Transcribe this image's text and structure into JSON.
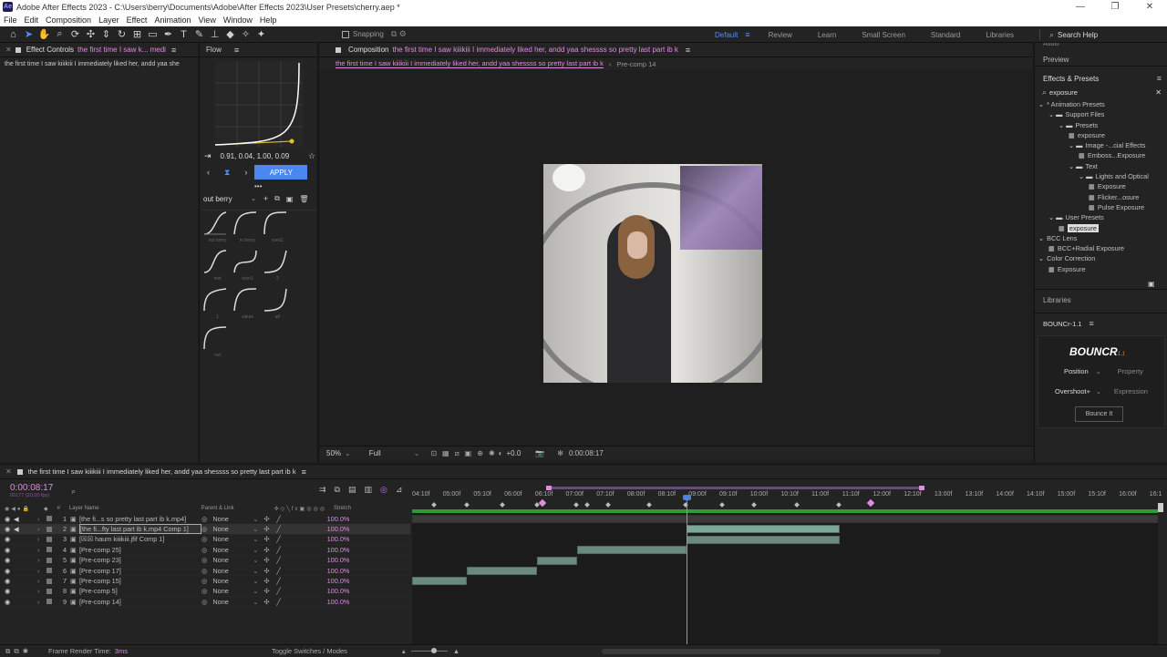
{
  "window": {
    "title": "Adobe After Effects 2023 - C:\\Users\\berry\\Documents\\Adobe\\After Effects 2023\\User Presets\\cherry.aep *",
    "logo": "Ae",
    "controls": [
      "—",
      "❐",
      "✕"
    ]
  },
  "menu": [
    "File",
    "Edit",
    "Composition",
    "Layer",
    "Effect",
    "Animation",
    "View",
    "Window",
    "Help"
  ],
  "toolbar": {
    "snapping": "Snapping",
    "workspaces": [
      "Default",
      "Review",
      "Learn",
      "Small Screen",
      "Standard",
      "Libraries"
    ],
    "active_workspace": "Default",
    "search_placeholder": "Search Help",
    "search_value": "Search Help"
  },
  "effect_controls": {
    "tab_label": "Effect Controls",
    "tab_layer": "the first time I saw k... medi",
    "subtitle": "the first time I saw kiiikiii I immediately liked her, andd yaa she"
  },
  "flow": {
    "tab_label": "Flow",
    "bezier": "0.91, 0.04, 1.00, 0.09",
    "apply": "APPLY",
    "preset_name": "out berry",
    "presets": [
      "out berry",
      "in berry",
      "yves1",
      "mid",
      "toon1",
      "2",
      "1",
      "sakes",
      "ah",
      "out"
    ]
  },
  "composition": {
    "tab_label": "Composition",
    "tab_name": "the first time I saw kiiikiii I immediately liked her, andd yaa shessss so pretty last part ib k",
    "breadcrumb_active": "the first time I saw kiiikiii I immediately liked her, andd yaa shessss so pretty last part ib k",
    "breadcrumb_other": "Pre-comp 14",
    "zoom": "50%",
    "resolution": "Full",
    "exposure": "+0.0",
    "timecode": "0:00:08:17"
  },
  "right_panel": {
    "audio": "Audio",
    "preview": "Preview",
    "effects_presets": "Effects & Presets",
    "search_value": "exposure",
    "tree": [
      {
        "label": "* Animation Presets",
        "depth": 0,
        "kind": "folder-open"
      },
      {
        "label": "Support Files",
        "depth": 1,
        "kind": "folder"
      },
      {
        "label": "Presets",
        "depth": 2,
        "kind": "folder"
      },
      {
        "label": "exposure",
        "depth": 3,
        "kind": "preset"
      },
      {
        "label": "Image -...cial Effects",
        "depth": 3,
        "kind": "folder"
      },
      {
        "label": "Emboss...Exposure",
        "depth": 4,
        "kind": "preset"
      },
      {
        "label": "Text",
        "depth": 3,
        "kind": "folder"
      },
      {
        "label": "Lights and Optical",
        "depth": 4,
        "kind": "folder"
      },
      {
        "label": "Exposure",
        "depth": 5,
        "kind": "preset"
      },
      {
        "label": "Flicker...osure",
        "depth": 5,
        "kind": "preset"
      },
      {
        "label": "Pulse Exposure",
        "depth": 5,
        "kind": "preset"
      },
      {
        "label": "User Presets",
        "depth": 1,
        "kind": "folder"
      },
      {
        "label": "exposure",
        "depth": 2,
        "kind": "preset-selected"
      },
      {
        "label": "BCC Lens",
        "depth": 0,
        "kind": "folder-open"
      },
      {
        "label": "BCC+Radial Exposure",
        "depth": 1,
        "kind": "preset"
      },
      {
        "label": "Color Correction",
        "depth": 0,
        "kind": "folder-open"
      },
      {
        "label": "Exposure",
        "depth": 1,
        "kind": "preset"
      }
    ],
    "libraries": "Libraries",
    "bounce_tab": "BOUNCr-1.1",
    "bounce_logo": "BOUNCR",
    "bounce_version": "1.1",
    "bounce_property": "Position",
    "bounce_property_label": "Property",
    "bounce_expression": "Overshoot+",
    "bounce_expression_label": "Expression",
    "bounce_button": "Bounce It"
  },
  "timeline": {
    "tab_label": "the first time I saw kiiikiii I immediately liked her, andd yaa shessss so pretty last part ib k",
    "timecode": "0:00:08:17",
    "frames": "00177 (20.00 fps)",
    "columns": {
      "layer_name": "Layer Name",
      "parent": "Parent & Link",
      "stretch": "Stretch"
    },
    "ruler": [
      "04:10f",
      "05:00f",
      "05:10f",
      "06:00f",
      "06:10f",
      "07:00f",
      "07:10f",
      "08:00f",
      "08:10f",
      "09:00f",
      "09:10f",
      "10:00f",
      "10:10f",
      "11:00f",
      "11:10f",
      "12:00f",
      "12:10f",
      "13:00f",
      "13:10f",
      "14:00f",
      "14:10f",
      "15:00f",
      "15:10f",
      "16:00f",
      "16:1"
    ],
    "layers": [
      {
        "num": "1",
        "name": "[the fi...s so pretty last part ib k.mp4]",
        "parent": "None",
        "stretch": "100.0%"
      },
      {
        "num": "2",
        "name": "[the fi...fty last part ib k.mp4 Comp 1]",
        "parent": "None",
        "stretch": "100.0%"
      },
      {
        "num": "3",
        "name": "[☒☒ haum kiiikiii.jfif Comp 1]",
        "parent": "None",
        "stretch": "100.0%"
      },
      {
        "num": "4",
        "name": "[Pre-comp 25]",
        "parent": "None",
        "stretch": "100.0%"
      },
      {
        "num": "5",
        "name": "[Pre-comp 23]",
        "parent": "None",
        "stretch": "100.0%"
      },
      {
        "num": "6",
        "name": "[Pre-comp 17]",
        "parent": "None",
        "stretch": "100.0%"
      },
      {
        "num": "7",
        "name": "[Pre-comp 15]",
        "parent": "None",
        "stretch": "100.0%"
      },
      {
        "num": "8",
        "name": "[Pre-comp 5]",
        "parent": "None",
        "stretch": "100.0%"
      },
      {
        "num": "9",
        "name": "[Pre-comp 14]",
        "parent": "None",
        "stretch": "100.0%"
      }
    ],
    "status_render_label": "Frame Render Time:",
    "status_render_value": "3ms",
    "toggle_label": "Toggle Switches / Modes"
  }
}
